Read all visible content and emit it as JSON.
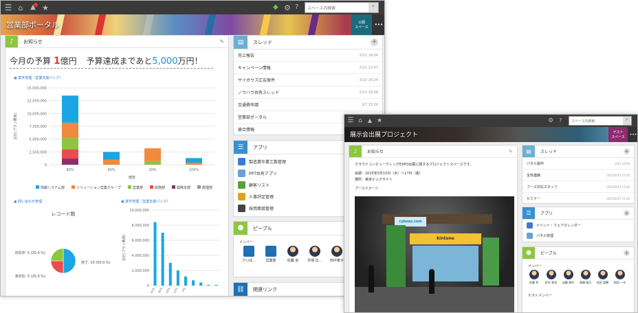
{
  "w1": {
    "search_placeholder": "スペース内検索",
    "banner_title": "営業部ポータル",
    "guest_label": "公開\nスペース",
    "more": "•••",
    "notice": {
      "title": "お知らせ",
      "pre": "今月の予算",
      "big": "1",
      "unit": "億円",
      "mid": "予算達成まであと",
      "target": "5,000",
      "end": "万円！"
    },
    "chart1": {
      "link": "案件管理（営業支援パック）",
      "ylabel": "合計(プラン費用)",
      "xlabel": "確度"
    },
    "chart2": {
      "link": "問い合わせ管理",
      "title": "レコード数"
    },
    "chart3": {
      "link": "案件管理（営業支援パック）",
      "ylabel": "合計(プラン費用)"
    },
    "thread": {
      "title": "スレッド",
      "items": [
        {
          "name": "売上報告",
          "time": "5/11 18:04"
        },
        {
          "name": "キャンペーン情報",
          "time": "5/11 13:47"
        },
        {
          "name": "サイボウズ広告案件",
          "time": "5/10 18:24"
        },
        {
          "name": "ノウハウ共有スレッド",
          "time": "5/10 18:08"
        },
        {
          "name": "交通費申請",
          "time": "3/7 15:56"
        },
        {
          "name": "営業部ポータル",
          "time": ""
        },
        {
          "name": "競合情報",
          "time": ""
        }
      ]
    },
    "apps": {
      "title": "アプリ",
      "items": [
        "製造業作業工数管理",
        "PPT共有アプリ",
        "顧客リスト",
        "人事評定管理",
        "採用面接管理"
      ]
    },
    "people": {
      "title": "ピープル",
      "members_label": "メンバー",
      "members": [
        "さいぼ…",
        "営業部",
        "佐藤 肖",
        "井岸 比…",
        "田中麦子",
        "山田 …"
      ]
    },
    "links": {
      "title": "関連リンク"
    }
  },
  "chart_data": [
    {
      "type": "bar",
      "stacked": true,
      "title": "",
      "ylabel": "合計(プラン費用)",
      "xlabel": "確度",
      "categories": [
        "80%",
        "60%",
        "20%",
        "100%"
      ],
      "ylim": [
        0,
        15000000
      ],
      "yticks": [
        "0",
        "2,500,000",
        "5,000,000",
        "7,500,000",
        "10,000,000",
        "12,500,000",
        "15,000,000"
      ],
      "series": [
        {
          "name": "情報システム部",
          "color": "#1aa6e4",
          "values": [
            5300000,
            1500000,
            0,
            900000
          ]
        },
        {
          "name": "ソリューション営業グループ",
          "color": "#f08a3c",
          "values": [
            3000000,
            1000000,
            2500000,
            400000
          ]
        },
        {
          "name": "営業部",
          "color": "#8dc63f",
          "values": [
            2200000,
            0,
            700000,
            0
          ]
        },
        {
          "name": "総務部",
          "color": "#e84d4d",
          "values": [
            1800000,
            0,
            0,
            0
          ]
        },
        {
          "name": "開発本部",
          "color": "#8c2d6e",
          "values": [
            1200000,
            0,
            0,
            0
          ]
        },
        {
          "name": "経理部",
          "color": "#999999",
          "values": [
            0,
            0,
            0,
            0
          ]
        }
      ]
    },
    {
      "type": "pie",
      "title": "レコード数",
      "slices": [
        {
          "label": "完了: 10 (50.0 %)",
          "value": 10,
          "color": "#1aa6e4"
        },
        {
          "label": "未対応: 5 (25.0 %)",
          "value": 5,
          "color": "#e84d4d"
        },
        {
          "label": "対応中: 5 (25.0 %)",
          "value": 5,
          "color": "#8dc63f"
        }
      ]
    },
    {
      "type": "bar",
      "title": "",
      "ylabel": "合計(プラン費用)",
      "ylim": [
        0,
        10000000
      ],
      "yticks": [
        "0",
        "2,000,000",
        "4,000,000",
        "6,000,000",
        "8,000,000",
        "10,000,000"
      ],
      "categories": [
        "40%",
        "30%",
        "20%",
        "10%",
        "0%",
        "",
        "",
        "",
        ""
      ],
      "values": [
        8400000,
        7000000,
        3000000,
        2000000,
        1200000,
        700000,
        400000,
        100000,
        100000
      ],
      "color": "#1aa6e4"
    }
  ],
  "w2": {
    "search_placeholder": "スペース内検索",
    "banner_title": "展示会出展プロジェクト",
    "guest_label": "ゲスト\nスペース",
    "more": "•••",
    "notice": {
      "title": "お知らせ",
      "line1": "クラウドコンピューティングEXPO出展に関するプロジェクトスペースです。",
      "line2": "会期：2015年5月15日（木）〜17日（金）",
      "line3": "場所：東京ビッグサイト",
      "line4": "ブースイメージ"
    },
    "booth": {
      "brand": "kintone",
      "sign": "cybozu.com"
    },
    "thread": {
      "title": "スレッド",
      "items": [
        {
          "name": "パネル製作",
          "time": "2/22 16:00"
        },
        {
          "name": "全体連絡",
          "time": "2015/6/15 15:45"
        },
        {
          "name": "ブース対応スタッフ",
          "time": "2015/6/15 15:44"
        },
        {
          "name": "セミナー",
          "time": "2015/6/15 15:44"
        }
      ]
    },
    "apps": {
      "title": "アプリ",
      "items": [
        "イベント・フェアカレンダー",
        "パネル管理"
      ]
    },
    "people": {
      "title": "ピープル",
      "members_label": "メンバー",
      "members": [
        "佐藤 幸",
        "鈴木 和也",
        "加藤 勇作",
        "高橋 瑞月",
        "松田 菜穂",
        "和田 一光"
      ],
      "guests_label": "ゲストメンバー"
    }
  }
}
